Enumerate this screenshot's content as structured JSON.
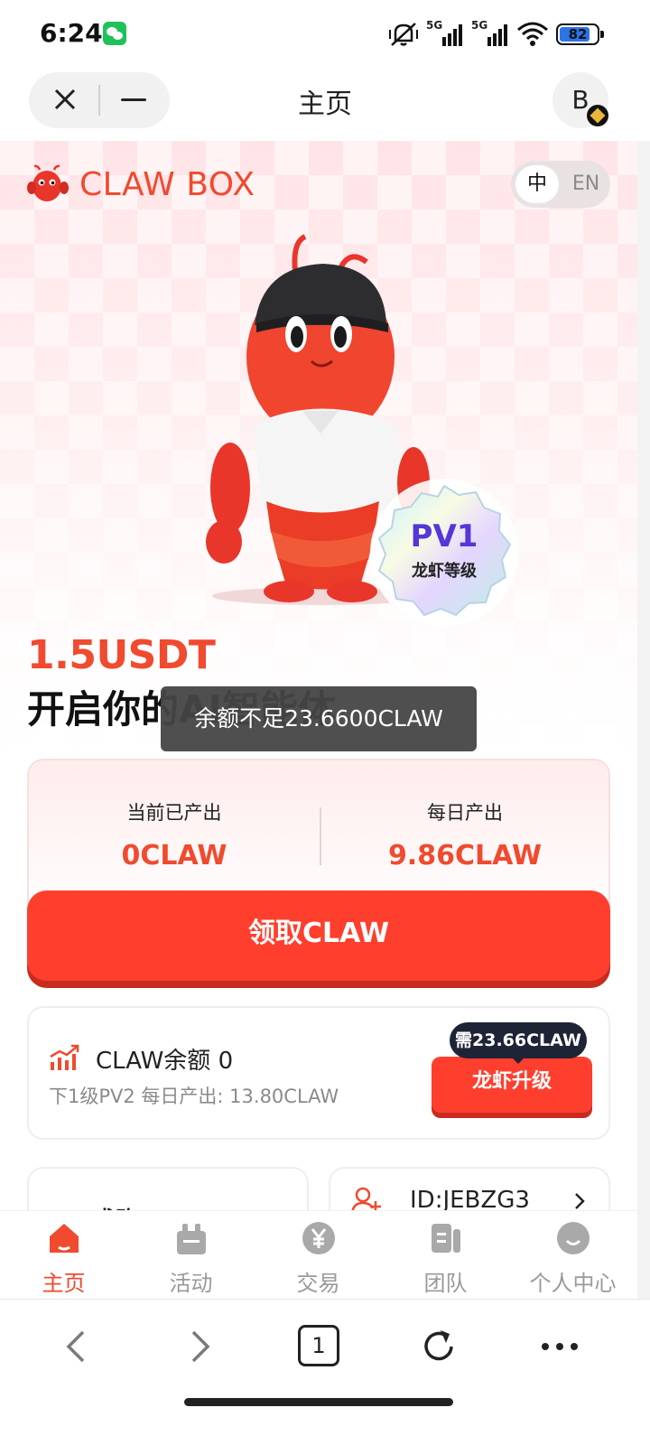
{
  "status_bar": {
    "time": "6:24",
    "network_1": "5G",
    "network_2": "5G",
    "battery": "82"
  },
  "header": {
    "title": "主页",
    "avatar_letter": "B"
  },
  "brand": {
    "name": "CLAW BOX",
    "lang_zh": "中",
    "lang_en": "EN"
  },
  "level_badge": {
    "level": "PV1",
    "label": "龙虾等级"
  },
  "hero": {
    "price": "1.5USDT",
    "slogan": "开启你的AI智能体"
  },
  "toast": {
    "message": "余额不足23.6600CLAW"
  },
  "output": {
    "current_label": "当前已产出",
    "current_value": "0CLAW",
    "daily_label": "每日产出",
    "daily_value": "9.86CLAW"
  },
  "claim_button": "领取CLAW",
  "balance": {
    "title": "CLAW余额 0",
    "subtitle": "下1级PV2 每日产出: 13.80CLAW",
    "need_tip": "需23.66CLAW",
    "upgrade_button": "龙虾升级"
  },
  "cards": {
    "left_text": "求购CLAW",
    "right_id": "ID:JEBZG3"
  },
  "tabs": [
    {
      "label": "主页",
      "icon": "home-icon",
      "active": true
    },
    {
      "label": "活动",
      "icon": "gift-icon",
      "active": false
    },
    {
      "label": "交易",
      "icon": "yuan-icon",
      "active": false
    },
    {
      "label": "团队",
      "icon": "team-icon",
      "active": false
    },
    {
      "label": "个人中心",
      "icon": "profile-icon",
      "active": false
    }
  ],
  "browser": {
    "tab_count": "1"
  },
  "colors": {
    "accent": "#f04a2f",
    "button": "#ff3f2e",
    "level_text": "#5536d6"
  }
}
